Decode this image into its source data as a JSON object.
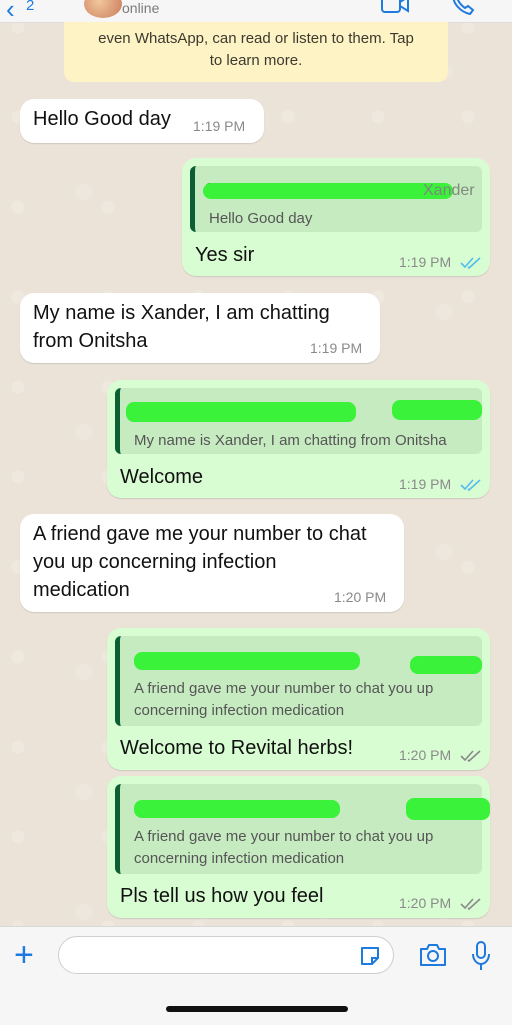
{
  "header": {
    "back_count": "2",
    "status": "online"
  },
  "notice": {
    "line1": "even WhatsApp, can read or listen to them. Tap",
    "line2": "to learn more."
  },
  "messages": [
    {
      "type": "in",
      "text": "Hello Good day",
      "time": "1:19 PM"
    },
    {
      "type": "out",
      "quote_sender": "Xander",
      "quote": "Hello Good day",
      "text": "Yes sir",
      "time": "1:19 PM",
      "status": "read"
    },
    {
      "type": "in",
      "text_line1": "My name is Xander, I am chatting",
      "text_line2": "from Onitsha",
      "time": "1:19 PM"
    },
    {
      "type": "out",
      "quote": "My name is Xander, I am chatting from Onitsha",
      "text": "Welcome",
      "time": "1:19 PM",
      "status": "read"
    },
    {
      "type": "in",
      "text_line1": "A friend gave me your number to chat",
      "text_line2": "you up concerning infection",
      "text_line3": "medication",
      "time": "1:20 PM"
    },
    {
      "type": "out",
      "quote_line1": "A friend gave me your number to chat you up",
      "quote_line2": "concerning infection medication",
      "text": "Welcome to Revital herbs!",
      "time": "1:20 PM",
      "status": "delivered"
    },
    {
      "type": "out",
      "quote_line1": "A friend gave me your number to chat you up",
      "quote_line2": "concerning infection medication",
      "text": "Pls tell us how you feel",
      "time": "1:20 PM",
      "status": "delivered"
    }
  ],
  "colors": {
    "read_tick": "#53bdeb",
    "delivered_tick": "#8a8a8a",
    "accent": "#1f7ae0",
    "redaction": "#39f239"
  },
  "input": {
    "placeholder": ""
  }
}
